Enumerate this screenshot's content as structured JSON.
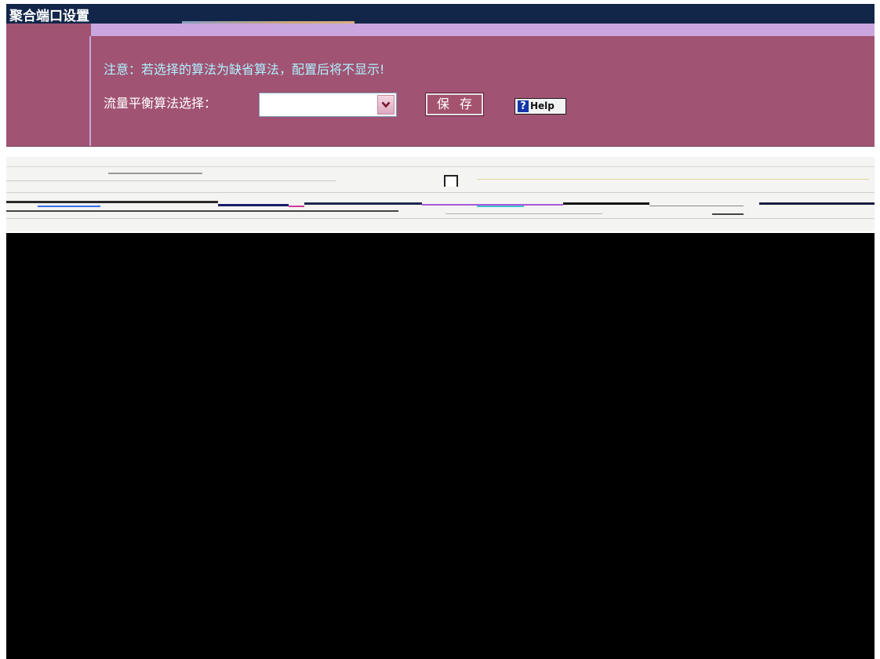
{
  "window": {
    "title": "聚合端口设置"
  },
  "notice": {
    "text": "注意：若选择的算法为缺省算法，配置后将不显示!"
  },
  "form": {
    "algorithm_label": "流量平衡算法选择：",
    "algorithm_selected": ""
  },
  "buttons": {
    "save_label": "保 存",
    "help_label": "Help",
    "help_icon_glyph": "?"
  },
  "colors": {
    "title_bar": "#12264a",
    "panel": "#a15373",
    "lavender": "#c9a6de",
    "notice_text": "#aef2ff"
  },
  "icons": {
    "select_arrow": "chevron-down-icon",
    "help": "question-icon"
  }
}
